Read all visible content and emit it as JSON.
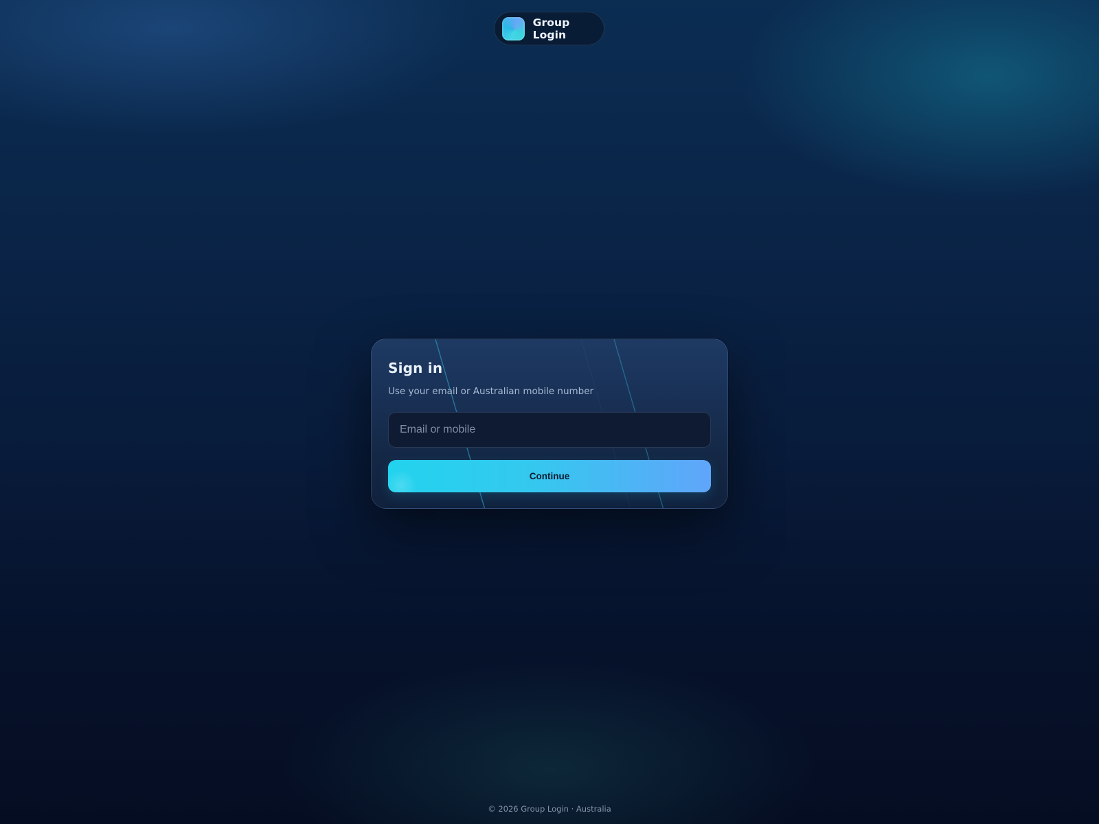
{
  "brand": {
    "name": "Group Login",
    "logo_icon": "app-logo-icon"
  },
  "signin": {
    "title": "Sign in",
    "subtitle": "Use your email or Australian mobile number",
    "input_placeholder": "Email or mobile",
    "input_value": "",
    "continue_label": "Continue"
  },
  "footer": {
    "text": "© 2026 Group Login · Australia"
  },
  "colors": {
    "accent_start": "#22d3ee",
    "accent_end": "#60a5fa",
    "background": "#081b3a",
    "card": "#1a3258"
  }
}
